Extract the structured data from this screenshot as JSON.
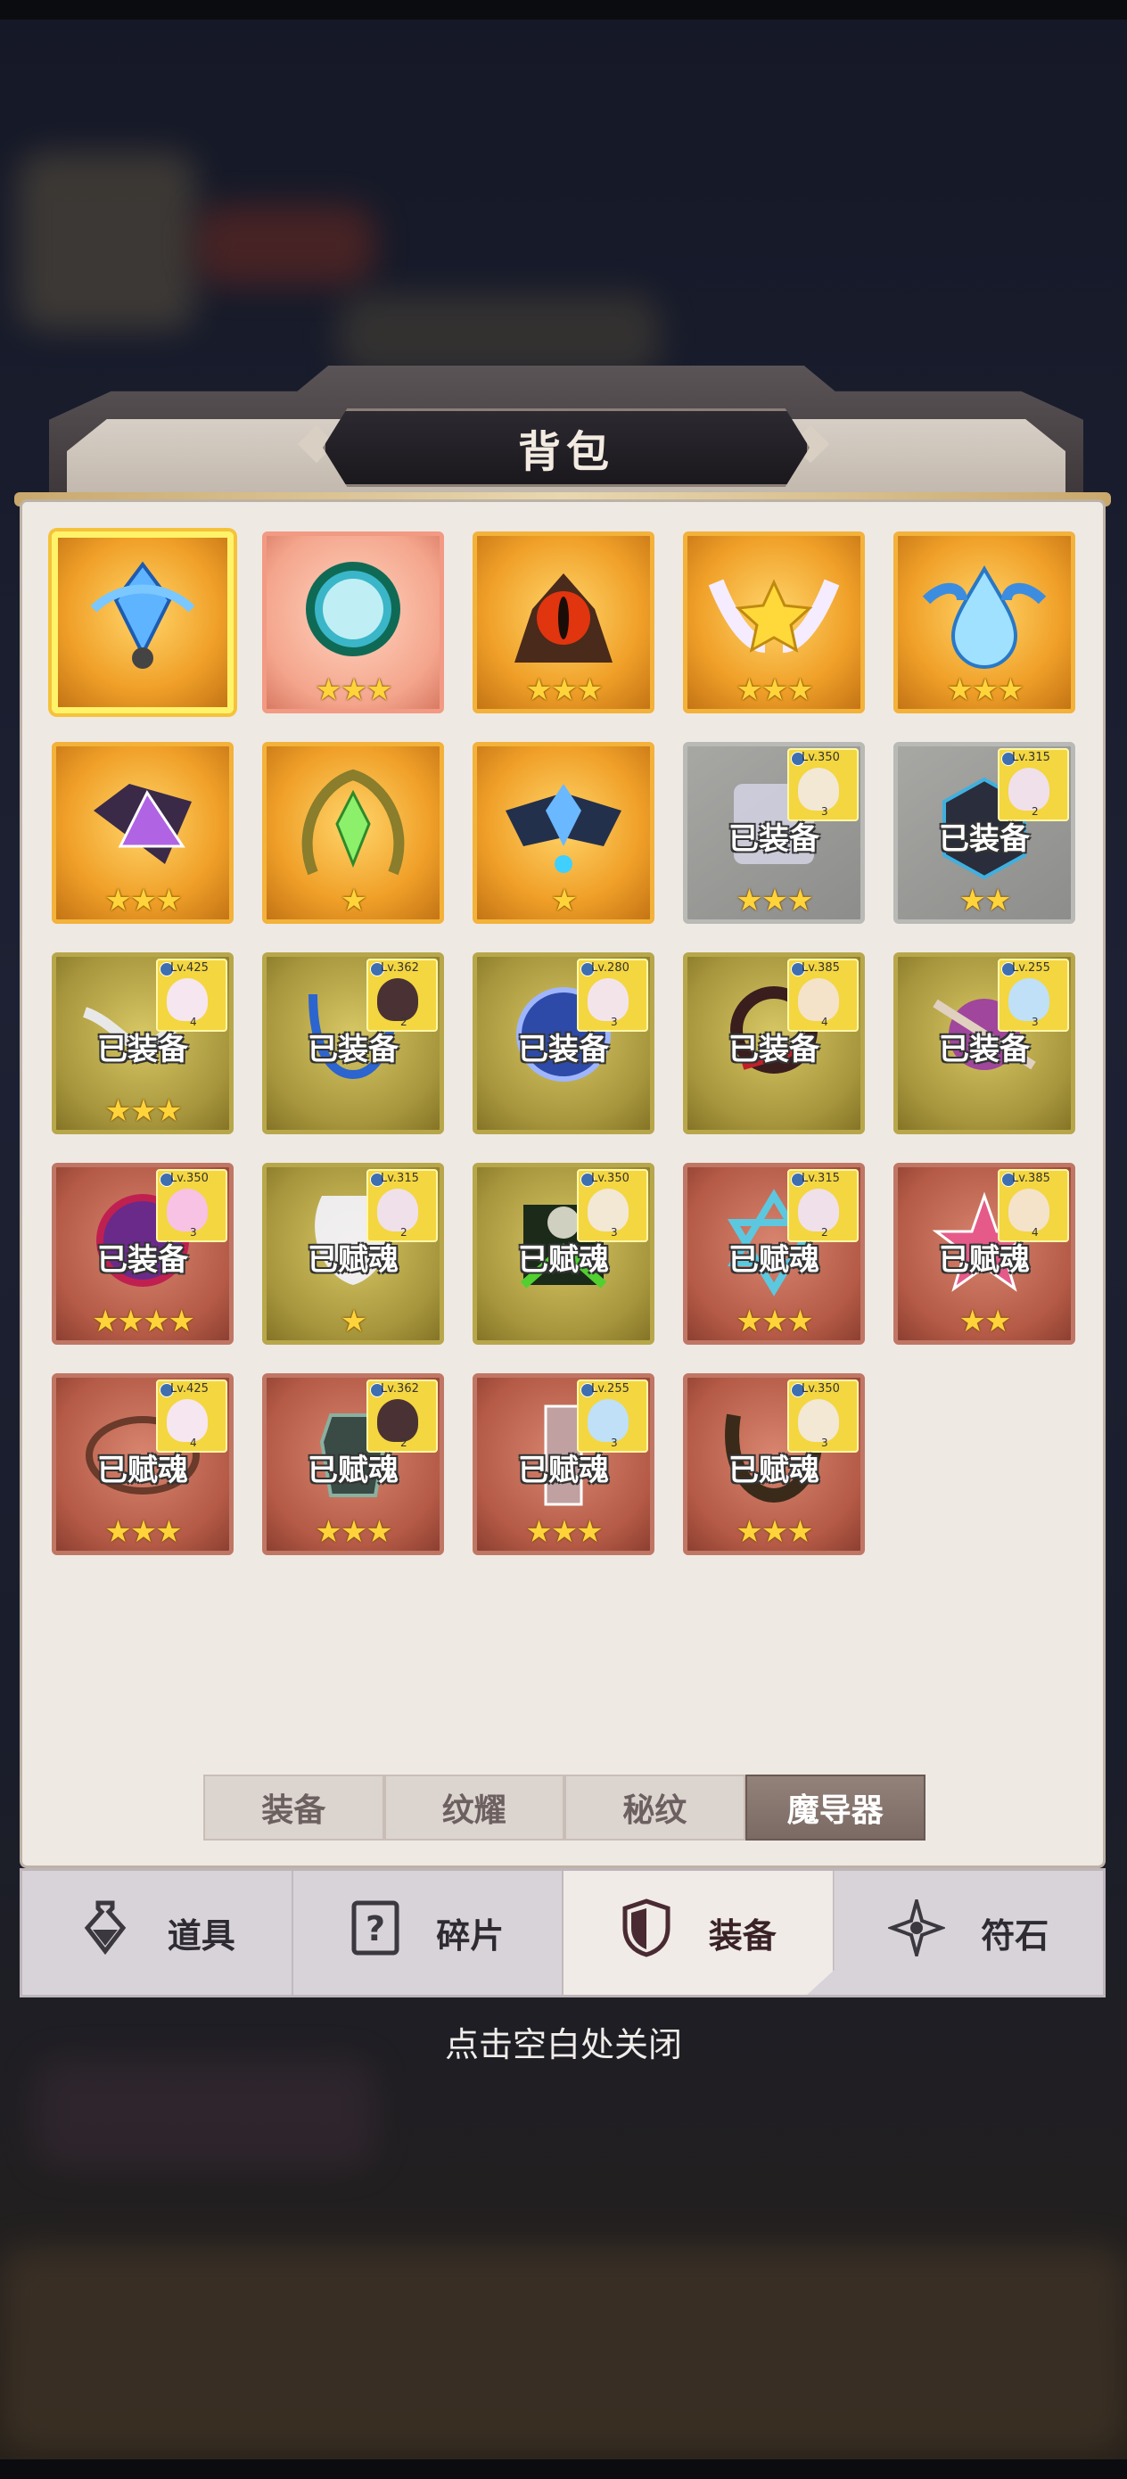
{
  "header": {
    "title": "背包"
  },
  "items": [
    {
      "row": 0,
      "col": 0,
      "bg": "gold",
      "selected": true,
      "art": "blue-crystal",
      "stars": 0,
      "status": ""
    },
    {
      "row": 0,
      "col": 1,
      "bg": "pinkred",
      "art": "dragon-mirror",
      "stars": 3,
      "status": ""
    },
    {
      "row": 0,
      "col": 2,
      "bg": "gold",
      "art": "fire-eye",
      "stars": 3,
      "status": ""
    },
    {
      "row": 0,
      "col": 3,
      "bg": "gold",
      "art": "winged-star",
      "stars": 3,
      "status": ""
    },
    {
      "row": 0,
      "col": 4,
      "bg": "gold",
      "art": "water-drop",
      "stars": 3,
      "status": ""
    },
    {
      "row": 1,
      "col": 0,
      "bg": "gold",
      "art": "purple-prism",
      "stars": 3,
      "status": ""
    },
    {
      "row": 1,
      "col": 1,
      "bg": "gold",
      "art": "green-crystal",
      "stars": 1,
      "status": ""
    },
    {
      "row": 1,
      "col": 2,
      "bg": "gold",
      "art": "dark-wings",
      "stars": 1,
      "status": ""
    },
    {
      "row": 1,
      "col": 3,
      "bg": "grey",
      "art": "scroll",
      "stars": 3,
      "status": "已装备",
      "owner": {
        "lv": "Lv.350",
        "stack": "3",
        "face": "#f2e8d4"
      }
    },
    {
      "row": 1,
      "col": 4,
      "bg": "grey",
      "art": "cube",
      "stars": 2,
      "status": "已装备",
      "owner": {
        "lv": "Lv.315",
        "stack": "2",
        "face": "#f0e0ea"
      }
    },
    {
      "row": 2,
      "col": 0,
      "bg": "olive",
      "art": "silver-wings",
      "stars": 3,
      "status": "已装备",
      "owner": {
        "lv": "Lv.425",
        "stack": "4",
        "face": "#f6e6ef"
      }
    },
    {
      "row": 2,
      "col": 1,
      "bg": "olive",
      "art": "blue-lyre",
      "stars": 0,
      "status": "已装备",
      "owner": {
        "lv": "Lv.362",
        "stack": "2",
        "face": "#4a3234"
      }
    },
    {
      "row": 2,
      "col": 2,
      "bg": "olive",
      "art": "blue-shield",
      "stars": 0,
      "status": "已装备",
      "owner": {
        "lv": "Lv.280",
        "stack": "3",
        "face": "#f3e4ea"
      }
    },
    {
      "row": 2,
      "col": 3,
      "bg": "olive",
      "art": "dark-ring",
      "stars": 0,
      "status": "已装备",
      "owner": {
        "lv": "Lv.385",
        "stack": "4",
        "face": "#f4e3c9"
      }
    },
    {
      "row": 2,
      "col": 4,
      "bg": "olive",
      "art": "purple-orb",
      "stars": 0,
      "status": "已装备",
      "owner": {
        "lv": "Lv.255",
        "stack": "3",
        "face": "#bfe0f7"
      }
    },
    {
      "row": 3,
      "col": 0,
      "bg": "rust",
      "art": "purple-sphere",
      "stars": 4,
      "status": "已装备",
      "owner": {
        "lv": "Lv.350",
        "stack": "3",
        "face": "#f7c2e3"
      }
    },
    {
      "row": 3,
      "col": 1,
      "bg": "olive",
      "art": "white-wings",
      "stars": 1,
      "status": "已赋魂",
      "owner": {
        "lv": "Lv.315",
        "stack": "2",
        "face": "#f0e0ea"
      }
    },
    {
      "row": 3,
      "col": 2,
      "bg": "olive",
      "art": "skull-gem",
      "stars": 0,
      "status": "已赋魂",
      "owner": {
        "lv": "Lv.350",
        "stack": "3",
        "face": "#f2e8d4"
      }
    },
    {
      "row": 3,
      "col": 3,
      "bg": "rust",
      "art": "hexagram",
      "stars": 3,
      "status": "已赋魂",
      "owner": {
        "lv": "Lv.315",
        "stack": "2",
        "face": "#f0e0ea"
      }
    },
    {
      "row": 3,
      "col": 4,
      "bg": "rust",
      "art": "pink-star",
      "stars": 2,
      "status": "已赋魂",
      "owner": {
        "lv": "Lv.385",
        "stack": "4",
        "face": "#f4e3c9"
      }
    },
    {
      "row": 4,
      "col": 0,
      "bg": "rust",
      "art": "orbit",
      "stars": 3,
      "status": "已赋魂",
      "owner": {
        "lv": "Lv.425",
        "stack": "4",
        "face": "#f6e6ef"
      }
    },
    {
      "row": 4,
      "col": 1,
      "bg": "rust",
      "art": "lantern",
      "stars": 3,
      "status": "已赋魂",
      "owner": {
        "lv": "Lv.362",
        "stack": "2",
        "face": "#4a3234"
      }
    },
    {
      "row": 4,
      "col": 2,
      "bg": "rust",
      "art": "pillar",
      "stars": 3,
      "status": "已赋魂",
      "owner": {
        "lv": "Lv.255",
        "stack": "3",
        "face": "#bfe0f7"
      }
    },
    {
      "row": 4,
      "col": 3,
      "bg": "rust",
      "art": "horns",
      "stars": 3,
      "status": "已赋魂",
      "owner": {
        "lv": "Lv.350",
        "stack": "3",
        "face": "#f2e8d4"
      }
    }
  ],
  "subtabs": [
    "装备",
    "纹耀",
    "秘纹",
    "魔导器"
  ],
  "subtab_active": 3,
  "nav": [
    {
      "label": "道具",
      "icon": "potion-icon"
    },
    {
      "label": "碎片",
      "icon": "question-card-icon"
    },
    {
      "label": "装备",
      "icon": "shield-icon"
    },
    {
      "label": "符石",
      "icon": "rune-star-icon"
    }
  ],
  "nav_active": 2,
  "close_hint": "点击空白处关闭"
}
